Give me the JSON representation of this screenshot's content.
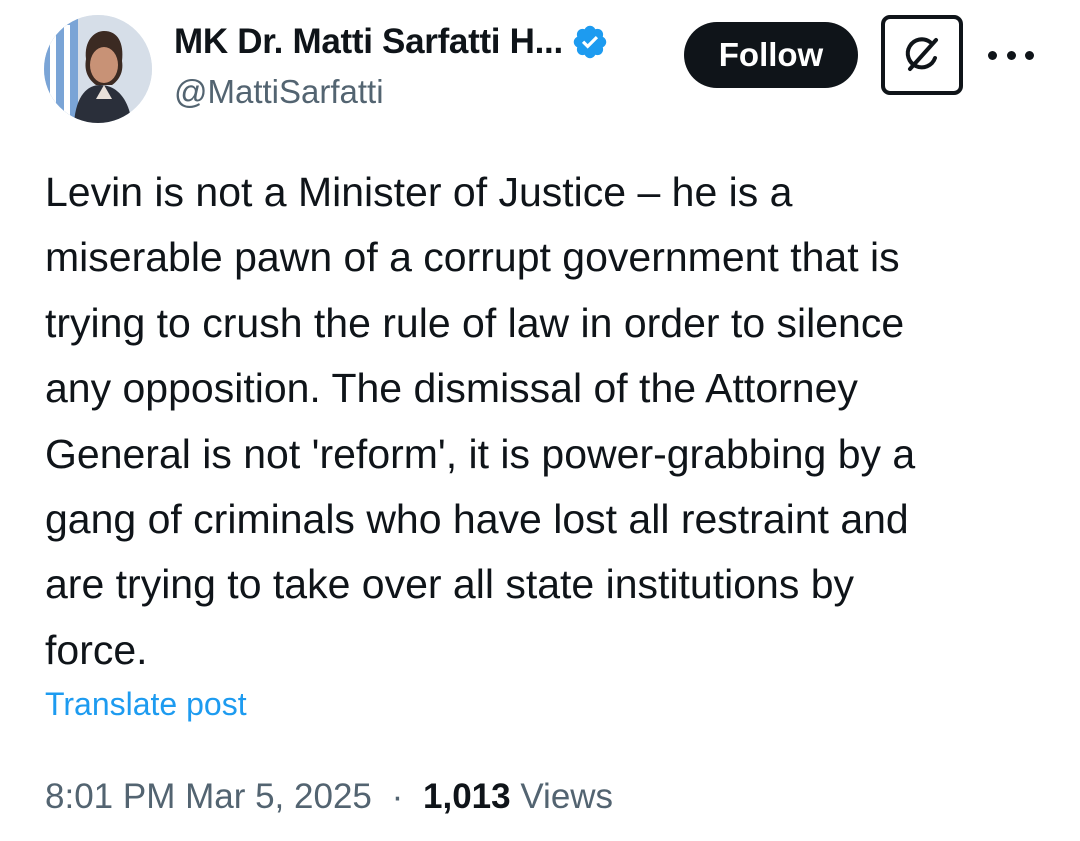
{
  "author": {
    "display_name": "MK Dr. Matti Sarfatti H...",
    "handle": "@MattiSarfatti",
    "verified": true
  },
  "actions": {
    "follow_label": "Follow",
    "grok_icon": "grok-slash-icon",
    "more_icon": "more-options-icon"
  },
  "post": {
    "lines": [
      "Levin is not a Minister of Justice – he is a",
      "miserable pawn of a corrupt government that is",
      "trying to crush the rule of law in order to silence",
      "any opposition. The dismissal of the Attorney",
      "General is not 'reform', it is power-grabbing by a",
      "gang of criminals who have lost all restraint and",
      "are trying to take over all state institutions by",
      "force."
    ],
    "translate_label": "Translate post"
  },
  "meta": {
    "time": "8:01 PM",
    "date": "Mar 5, 2025",
    "separator": "·",
    "views_count": "1,013",
    "views_label": "Views"
  },
  "colors": {
    "text": "#0f1419",
    "secondary": "#536471",
    "link": "#1d9bf0",
    "verified_badge": "#1d9bf0",
    "follow_bg": "#0f1419"
  }
}
